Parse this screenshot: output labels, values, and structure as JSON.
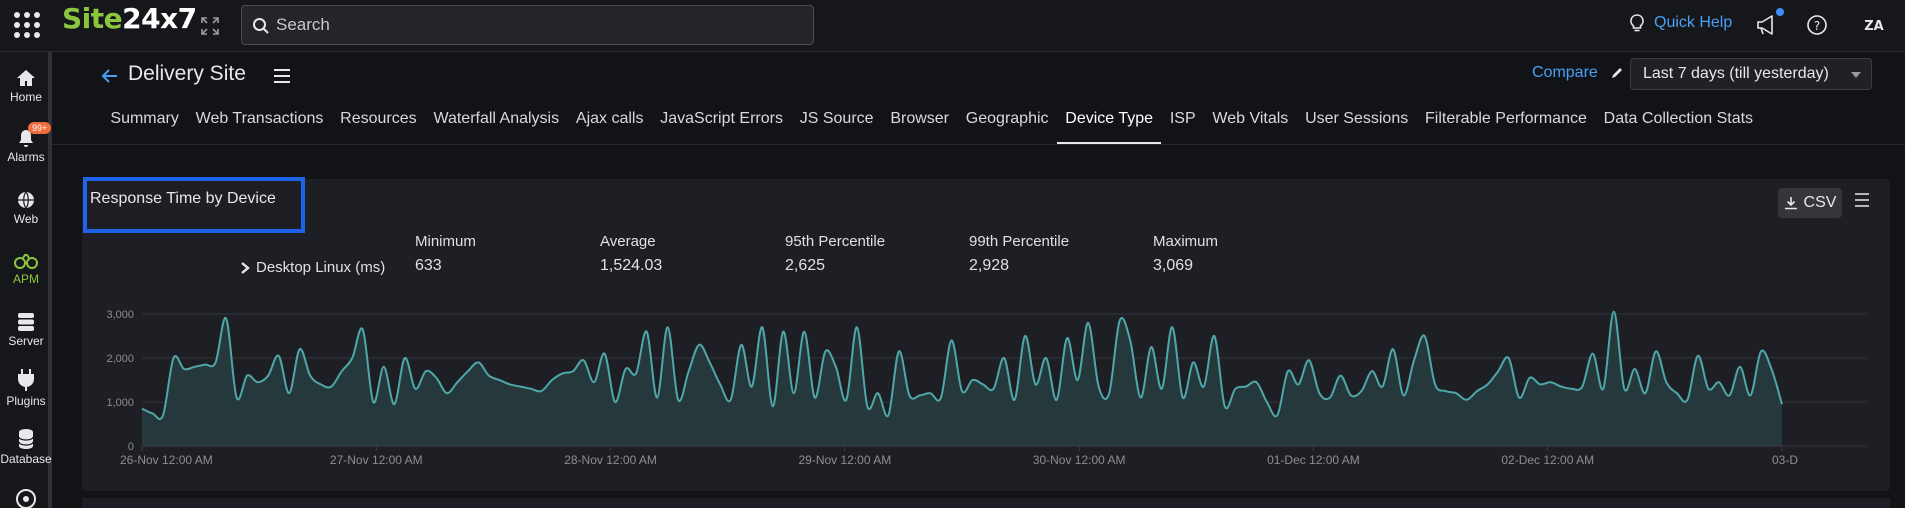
{
  "topbar": {
    "logo_part1": "Site",
    "logo_part2": "24x7",
    "search_placeholder": "Search",
    "quick_help": "Quick Help"
  },
  "sidebar": {
    "items": [
      {
        "label": "Home",
        "icon": "home-icon"
      },
      {
        "label": "Alarms",
        "icon": "bell-icon",
        "badge": "99+"
      },
      {
        "label": "Web",
        "icon": "globe-icon"
      },
      {
        "label": "APM",
        "icon": "binoculars-icon",
        "active": true
      },
      {
        "label": "Server",
        "icon": "server-icon"
      },
      {
        "label": "Plugins",
        "icon": "plug-icon"
      },
      {
        "label": "Database",
        "icon": "database-icon"
      }
    ]
  },
  "header": {
    "title": "Delivery Site",
    "compare": "Compare",
    "date_range": "Last 7 days (till yesterday)"
  },
  "tabs": [
    {
      "label": "Summary"
    },
    {
      "label": "Web Transactions"
    },
    {
      "label": "Resources"
    },
    {
      "label": "Waterfall Analysis"
    },
    {
      "label": "Ajax calls"
    },
    {
      "label": "JavaScript Errors"
    },
    {
      "label": "JS Source"
    },
    {
      "label": "Browser"
    },
    {
      "label": "Geographic"
    },
    {
      "label": "Device Type",
      "active": true
    },
    {
      "label": "ISP"
    },
    {
      "label": "Web Vitals"
    },
    {
      "label": "User Sessions"
    },
    {
      "label": "Filterable Performance"
    },
    {
      "label": "Data Collection Stats"
    }
  ],
  "panel": {
    "title": "Response Time by Device",
    "csv_label": "CSV",
    "stats": {
      "columns": [
        "Minimum",
        "Average",
        "95th Percentile",
        "99th Percentile",
        "Maximum"
      ],
      "row_label": "Desktop Linux (ms)",
      "values": [
        "633",
        "1,524.03",
        "2,625",
        "2,928",
        "3,069"
      ]
    }
  },
  "colors": {
    "accent": "#4a9ff5",
    "brand_green": "#8cc63f",
    "series_line": "#4fa7a9",
    "series_fill": "#25393d",
    "highlight": "#1f64e8",
    "badge": "#f26b3a"
  },
  "chart_data": {
    "type": "area",
    "title": "",
    "ylabel": "",
    "xlabel": "",
    "ylim": [
      0,
      3000
    ],
    "yticks": [
      "0",
      "1,000",
      "2,000",
      "3,000"
    ],
    "xtick_labels": [
      "26-Nov 12:00 AM",
      "27-Nov 12:00 AM",
      "28-Nov 12:00 AM",
      "29-Nov 12:00 AM",
      "30-Nov 12:00 AM",
      "01-Dec 12:00 AM",
      "02-Dec 12:00 AM",
      "03-D"
    ],
    "grid": true,
    "series": [
      {
        "name": "Desktop Linux (ms)",
        "values": [
          850,
          740,
          700,
          2000,
          1750,
          1800,
          1850,
          1900,
          2900,
          1100,
          1600,
          1450,
          1600,
          2050,
          1200,
          2200,
          1600,
          1400,
          1350,
          1700,
          2000,
          2650,
          1000,
          1800,
          950,
          2000,
          1300,
          1700,
          1550,
          1200,
          1450,
          1700,
          1900,
          1600,
          1500,
          1400,
          1350,
          1300,
          1250,
          1500,
          1650,
          1700,
          1950,
          1450,
          2100,
          1000,
          1750,
          1650,
          2600,
          1100,
          2700,
          1050,
          1700,
          2300,
          1900,
          1400,
          1050,
          2300,
          1350,
          2700,
          900,
          2600,
          1200,
          2600,
          1100,
          2150,
          1800,
          1050,
          2700,
          900,
          1200,
          700,
          2150,
          1150,
          1150,
          1200,
          1100,
          2400,
          1250,
          1500,
          1400,
          1300,
          2000,
          1050,
          2500,
          1400,
          2000,
          1050,
          2450,
          1500,
          2800,
          1350,
          1200,
          2850,
          2400,
          1100,
          2250,
          1300,
          2700,
          1100,
          1900,
          1350,
          2500,
          900,
          1300,
          1350,
          1450,
          1000,
          700,
          1700,
          1400,
          1950,
          1200,
          1100,
          1600,
          1150,
          1250,
          1700,
          1350,
          2200,
          1150,
          1950,
          2500,
          1400,
          1250,
          1200,
          1050,
          1250,
          1400,
          1700,
          2000,
          1100,
          1550,
          1400,
          1450,
          1350,
          1300,
          1350,
          2100,
          1300,
          3050,
          1300,
          1750,
          1200,
          2150,
          1450,
          1200,
          1050,
          2050,
          1300,
          1450,
          1150,
          1800,
          1150,
          2150,
          1750,
          950
        ]
      }
    ]
  }
}
